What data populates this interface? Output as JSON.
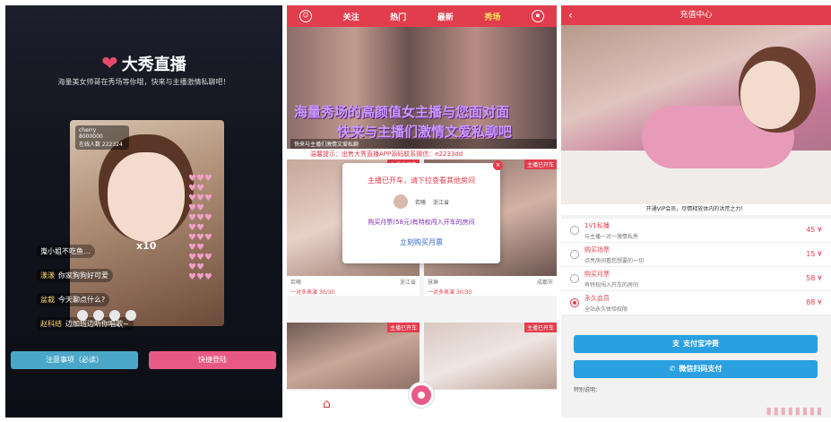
{
  "login": {
    "app_name": "大秀直播",
    "slogan": "海量美女帅哥在秀场等你哦，快来与主播激情私聊吧！",
    "stream_host": "cherry",
    "stream_id": "8000000",
    "stream_viewers": "在线人数 222324",
    "chat": [
      {
        "name": "",
        "text": "嵬小姐不吃鱼…"
      },
      {
        "name": "漾漾",
        "text": "你家狗狗好可爱"
      },
      {
        "name": "盆栽",
        "text": "今天聊点什么?"
      },
      {
        "name": "赵科结",
        "text": "边加班边听你唱歌~"
      }
    ],
    "gift_count": "x10",
    "notice_button": "注意事项（必读）",
    "login_button": "快捷登陆"
  },
  "live": {
    "tabs": [
      "关注",
      "热门",
      "最新",
      "秀场"
    ],
    "active_tab": "秀场",
    "banner_line1": "海量秀场的高颜值女主播与您面对面",
    "banner_line2": "快来与主播们激情文爱私聊吧",
    "banner_caption": "快来与主播们激情文爱私聊",
    "marquee": "温馨提示：出售大秀直播APP源码联系微信：e2233dd",
    "modal": {
      "title": "主播已开车，请下拉查看其他房间",
      "host_name": "若曦",
      "host_location": "浙江省",
      "buy_ticket": "购买月票(58元)有特权闯入开车的房间",
      "buy_month": "立刻购买月票"
    },
    "cards": [
      {
        "tag": "主播已开车",
        "name": "若曦",
        "location": "浙江省",
        "status": "一对多表演",
        "count": "30/30"
      },
      {
        "tag": "主播已开车",
        "name": "慧琳",
        "location": "成都市",
        "status": "一对多表演",
        "count": "30/30"
      },
      {
        "tag": "主播已开车"
      },
      {
        "tag": "主播已开车"
      }
    ]
  },
  "recharge": {
    "title": "充值中心",
    "vip_line": "开通VIP会员，尽情释放体内的洪荒之力！",
    "plans": [
      {
        "name": "1V1私播",
        "desc": "与主播一对一激情私秀",
        "price": "45 ¥",
        "selected": false
      },
      {
        "name": "购买场票",
        "desc": "点亮房间看您想要的一切",
        "price": "15 ¥",
        "selected": false
      },
      {
        "name": "购买月票",
        "desc": "有特权闯入开车的房间",
        "price": "58 ¥",
        "selected": false
      },
      {
        "name": "永久会员",
        "desc": "全站永久体验权限",
        "price": "88 ¥",
        "selected": true
      }
    ],
    "alipay_button": "支付宝冲费",
    "wechat_button": "微信扫码支付",
    "note_label": "特别说明：",
    "accent_color": "#e23d4c",
    "pay_color": "#2aa0e0"
  }
}
